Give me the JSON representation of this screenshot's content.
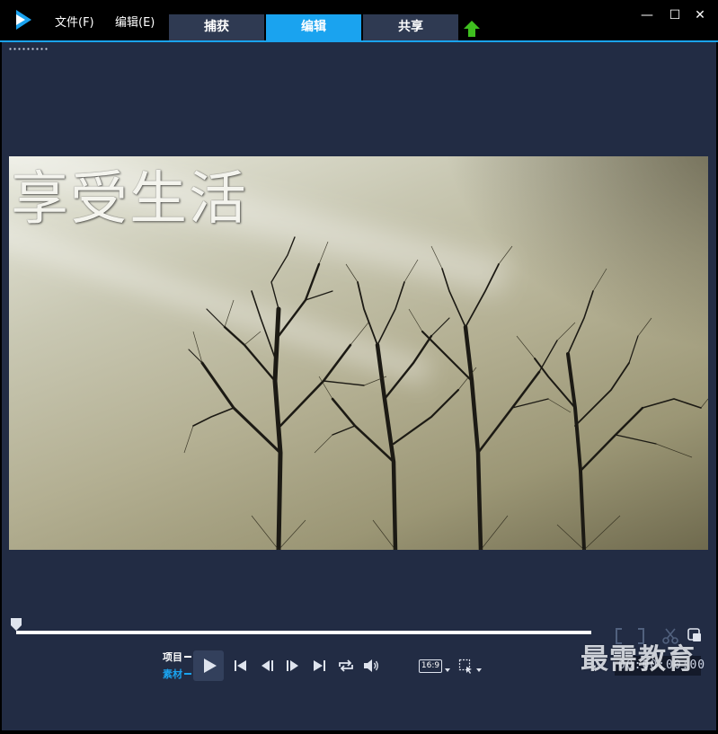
{
  "menu": {
    "file": "文件(F)",
    "edit": "编辑(E)"
  },
  "tabs": [
    {
      "label": "捕获",
      "active": false
    },
    {
      "label": "编辑",
      "active": true
    },
    {
      "label": "共享",
      "active": false
    }
  ],
  "window_controls": {
    "minimize": "—",
    "maximize": "☐",
    "close": "✕"
  },
  "preview": {
    "overlay_title": "享受生活"
  },
  "player": {
    "mode_project": "项目",
    "mode_clip": "素材",
    "aspect_ratio": "16:9",
    "timecode": "00:00:00:00",
    "scrub_position": 0.0
  },
  "watermark": "最需教育",
  "colors": {
    "accent": "#1aa3ef",
    "panel": "#222c44",
    "tab": "#2f3a52",
    "upload_green": "#3fbf1f"
  }
}
